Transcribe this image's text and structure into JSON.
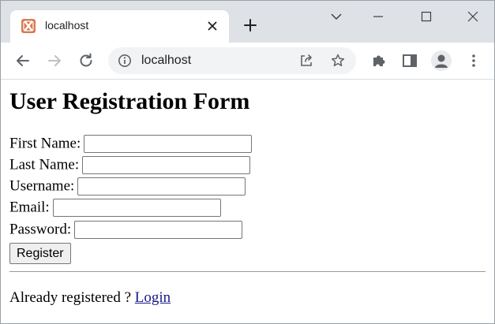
{
  "browser": {
    "tab_title": "localhost",
    "address": "localhost",
    "icons": {
      "favicon": "xampp-icon",
      "tab_close": "close-icon",
      "new_tab": "plus-icon",
      "back": "back-arrow-icon",
      "forward": "forward-arrow-icon",
      "reload": "reload-icon",
      "site_info": "info-icon",
      "share": "share-icon",
      "bookmark": "star-icon",
      "extensions": "puzzle-icon",
      "side_panel": "side-panel-icon",
      "profile": "profile-icon",
      "menu": "kebab-menu-icon",
      "minimize": "minimize-icon",
      "maximize": "maximize-icon",
      "close_window": "close-icon",
      "tab_search": "chevron-down-icon"
    }
  },
  "form": {
    "title": "User Registration Form",
    "fields": [
      {
        "label": "First Name:",
        "value": ""
      },
      {
        "label": "Last Name:",
        "value": ""
      },
      {
        "label": "Username:",
        "value": ""
      },
      {
        "label": "Email:",
        "value": ""
      },
      {
        "label": "Password:",
        "value": ""
      }
    ],
    "submit_label": "Register"
  },
  "footer": {
    "text": "Already registered ? ",
    "link_label": "Login"
  },
  "colors": {
    "chrome_bg": "#dee1e6",
    "favicon": "#d87a50",
    "link": "#1a1a8c"
  }
}
